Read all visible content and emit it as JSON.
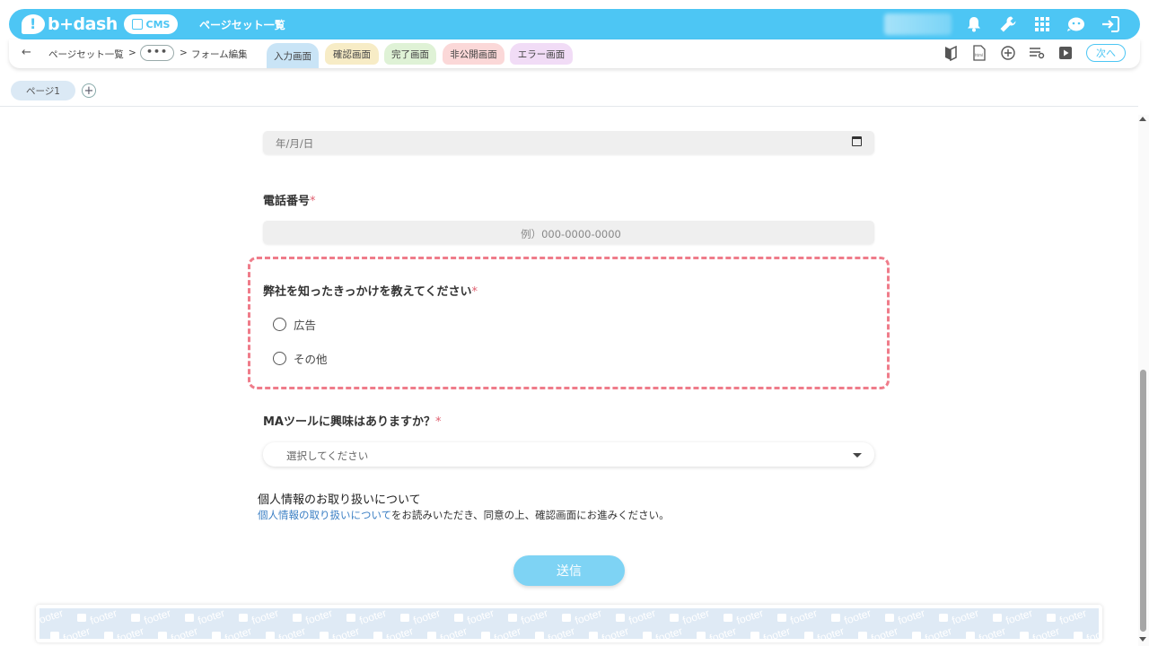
{
  "topbar": {
    "logo_text": "b+dash",
    "cms_label": "CMS",
    "title": "ページセット一覧"
  },
  "subbar": {
    "back_arrow": "←",
    "breadcrumb_root": "ページセット一覧",
    "sep1": ">",
    "ellipsis": "•••",
    "sep2": ">",
    "breadcrumb_current": "フォーム編集",
    "tabs": [
      {
        "label": "入力画面",
        "color": "#c9e4f6"
      },
      {
        "label": "確認画面",
        "color": "#f7ecc6"
      },
      {
        "label": "完了画面",
        "color": "#dff2d6"
      },
      {
        "label": "非公開画面",
        "color": "#fbd8d8"
      },
      {
        "label": "エラー画面",
        "color": "#f1dcf6"
      }
    ],
    "next_label": "次へ"
  },
  "pages": {
    "tab_label": "ページ1",
    "add_label": "+"
  },
  "form": {
    "date_placeholder": "年/月/日",
    "tel_label": "電話番号",
    "tel_placeholder": "例）000-0000-0000",
    "required_mark": "*",
    "source_question": "弊社を知ったきっかけを教えてください",
    "source_options": [
      "広告",
      "その他"
    ],
    "ma_question": "MAツールに興味はありますか？",
    "ma_placeholder": "選択してください",
    "privacy_title": "個人情報のお取り扱いについて",
    "privacy_link": "個人情報の取り扱いについて",
    "privacy_rest": "をお読みいただき、同意の上、確認画面にお進みください。",
    "submit_label": "送信"
  },
  "footer": {
    "watermark": "footer"
  },
  "colors": {
    "brand": "#4dc6f4",
    "highlight_border": "#ef7c8a",
    "required": "#e06070",
    "link": "#3b7fc4"
  }
}
